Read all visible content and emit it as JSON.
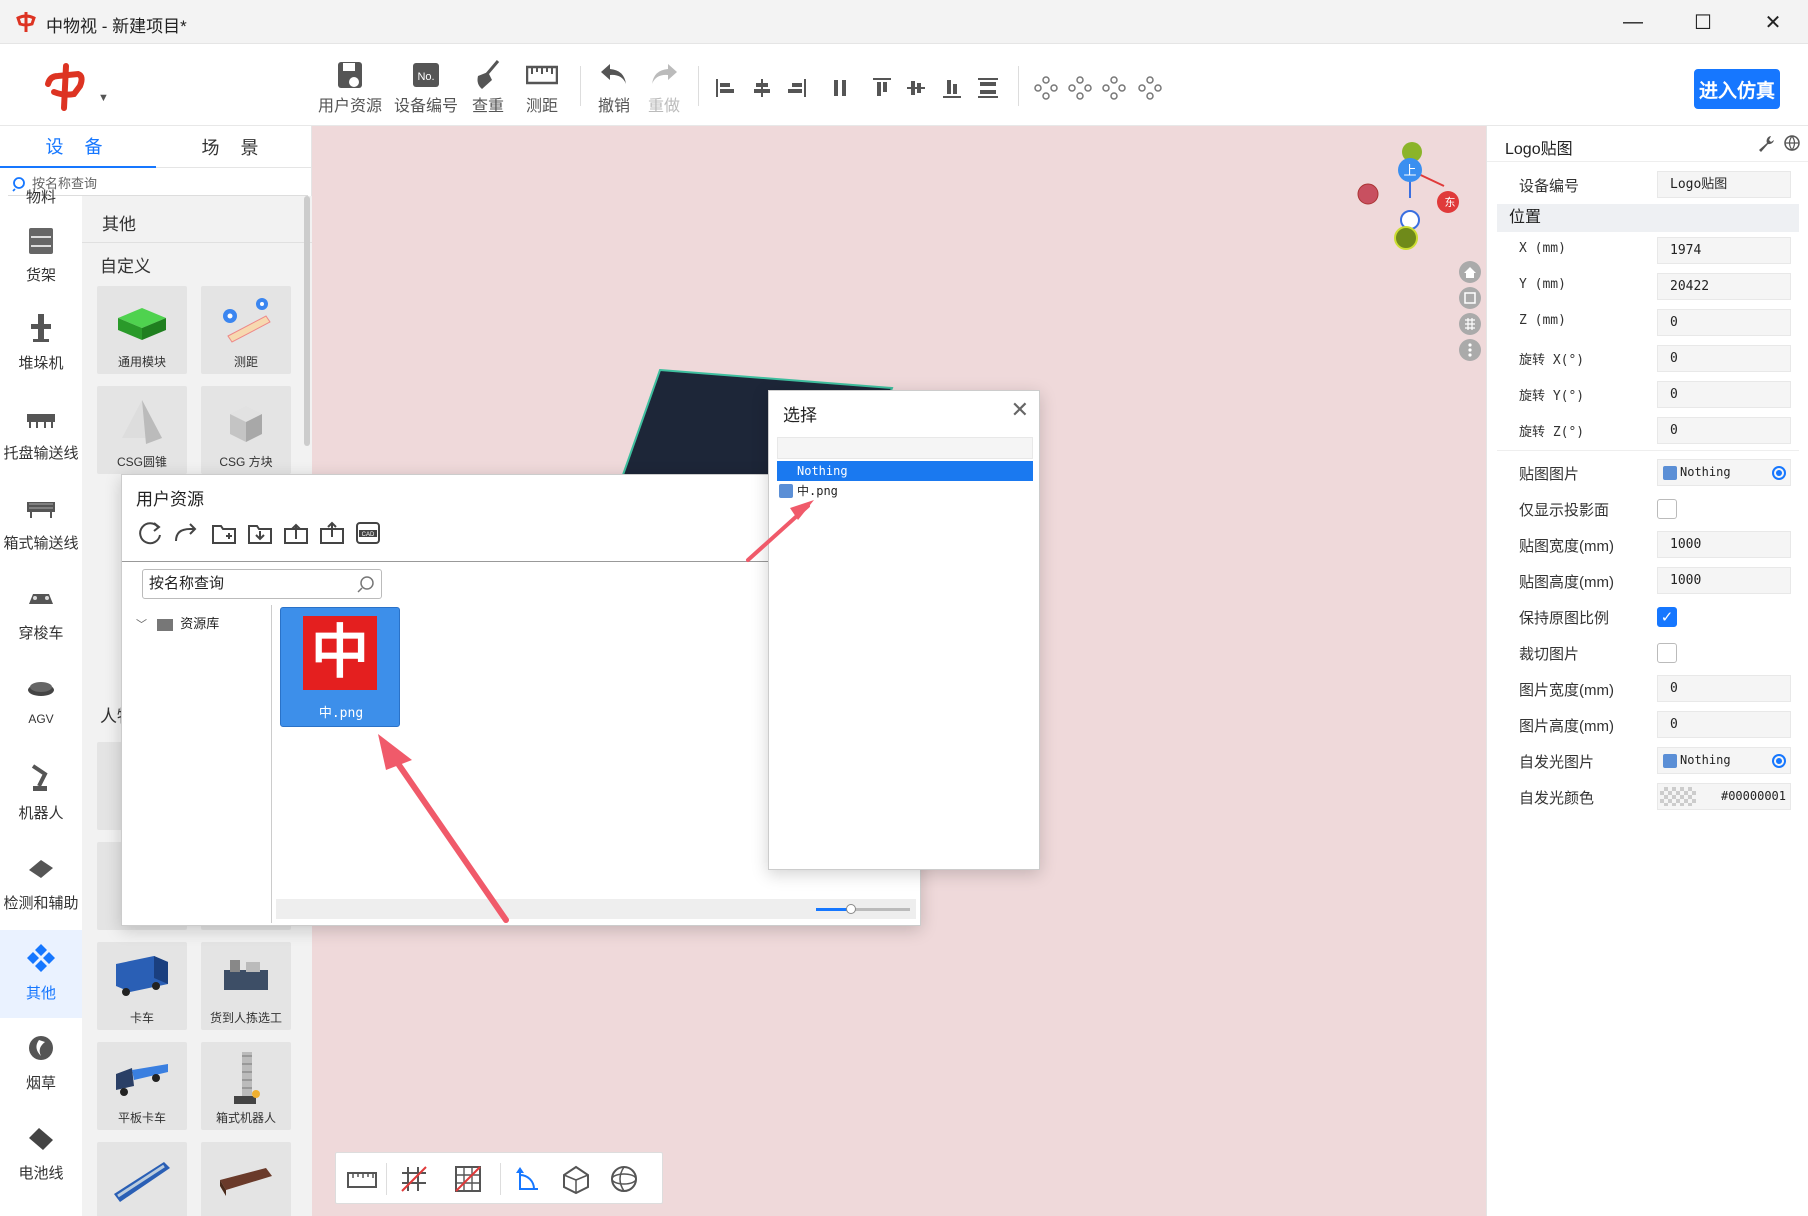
{
  "window": {
    "app_title": "中物视 - 新建项目*",
    "minimize": "—",
    "maximize": "☐",
    "close": "✕"
  },
  "toolbar": {
    "buttons": [
      {
        "label": "用户资源",
        "icon": "save-icon"
      },
      {
        "label": "设备编号",
        "icon": "number-icon"
      },
      {
        "label": "查重",
        "icon": "broom-icon"
      },
      {
        "label": "测距",
        "icon": "ruler-icon"
      },
      {
        "label": "撤销",
        "icon": "undo-icon"
      },
      {
        "label": "重做",
        "icon": "redo-icon"
      }
    ],
    "enter_sim": "进入仿真"
  },
  "left_panel": {
    "tabs": [
      "设 备",
      "场 景"
    ],
    "search_placeholder": "按名称查询",
    "categories": [
      "物料",
      "货架",
      "堆垛机",
      "托盘输送线",
      "箱式输送线",
      "穿梭车",
      "AGV",
      "机器人",
      "检测和辅助",
      "其他",
      "烟草",
      "电池线"
    ],
    "active_category": "其他",
    "section_title": "其他",
    "subsection_custom": "自定义",
    "subsection_people": "人物",
    "devices": [
      {
        "label": "通用模块"
      },
      {
        "label": "测距"
      },
      {
        "label": "CSG圆锥"
      },
      {
        "label": "CSG 方块"
      },
      {
        "label": "卡车"
      },
      {
        "label": "货到人拣选工"
      },
      {
        "label": "平板卡车"
      },
      {
        "label": "箱式机器人"
      }
    ]
  },
  "user_resources_dialog": {
    "title": "用户资源",
    "search_placeholder": "按名称查询",
    "tree_root": "资源库",
    "file_name": "中.png",
    "file_thumb_char": "中"
  },
  "select_dialog": {
    "title": "选择",
    "options": [
      "Nothing",
      "中.png"
    ],
    "selected": "Nothing"
  },
  "right_panel": {
    "title": "Logo贴图",
    "device_code_label": "设备编号",
    "device_code_value": "Logo贴图",
    "position_section": "位置",
    "rows": [
      {
        "label": "X (mm)",
        "value": "1974"
      },
      {
        "label": "Y (mm)",
        "value": "20422"
      },
      {
        "label": "Z (mm)",
        "value": "0"
      },
      {
        "label": "旋转 X(°)",
        "value": "0"
      },
      {
        "label": "旋转 Y(°)",
        "value": "0"
      },
      {
        "label": "旋转 Z(°)",
        "value": "0"
      }
    ],
    "texture_label": "贴图图片",
    "texture_value": "Nothing",
    "shadow_only_label": "仅显示投影面",
    "tex_width_label": "贴图宽度(mm)",
    "tex_width_value": "1000",
    "tex_height_label": "贴图高度(mm)",
    "tex_height_value": "1000",
    "keep_ratio_label": "保持原图比例",
    "keep_ratio_checked": true,
    "crop_label": "裁切图片",
    "img_width_label": "图片宽度(mm)",
    "img_width_value": "0",
    "img_height_label": "图片高度(mm)",
    "img_height_value": "0",
    "emissive_label": "自发光图片",
    "emissive_value": "Nothing",
    "emissive_color_label": "自发光颜色",
    "emissive_color_value": "#00000001"
  },
  "gizmo": {
    "up_label": "上",
    "east_label": "东"
  },
  "colors": {
    "accent": "#1677ff",
    "viewport_bg": "#efd9da",
    "logo_red": "#e41f1f"
  }
}
